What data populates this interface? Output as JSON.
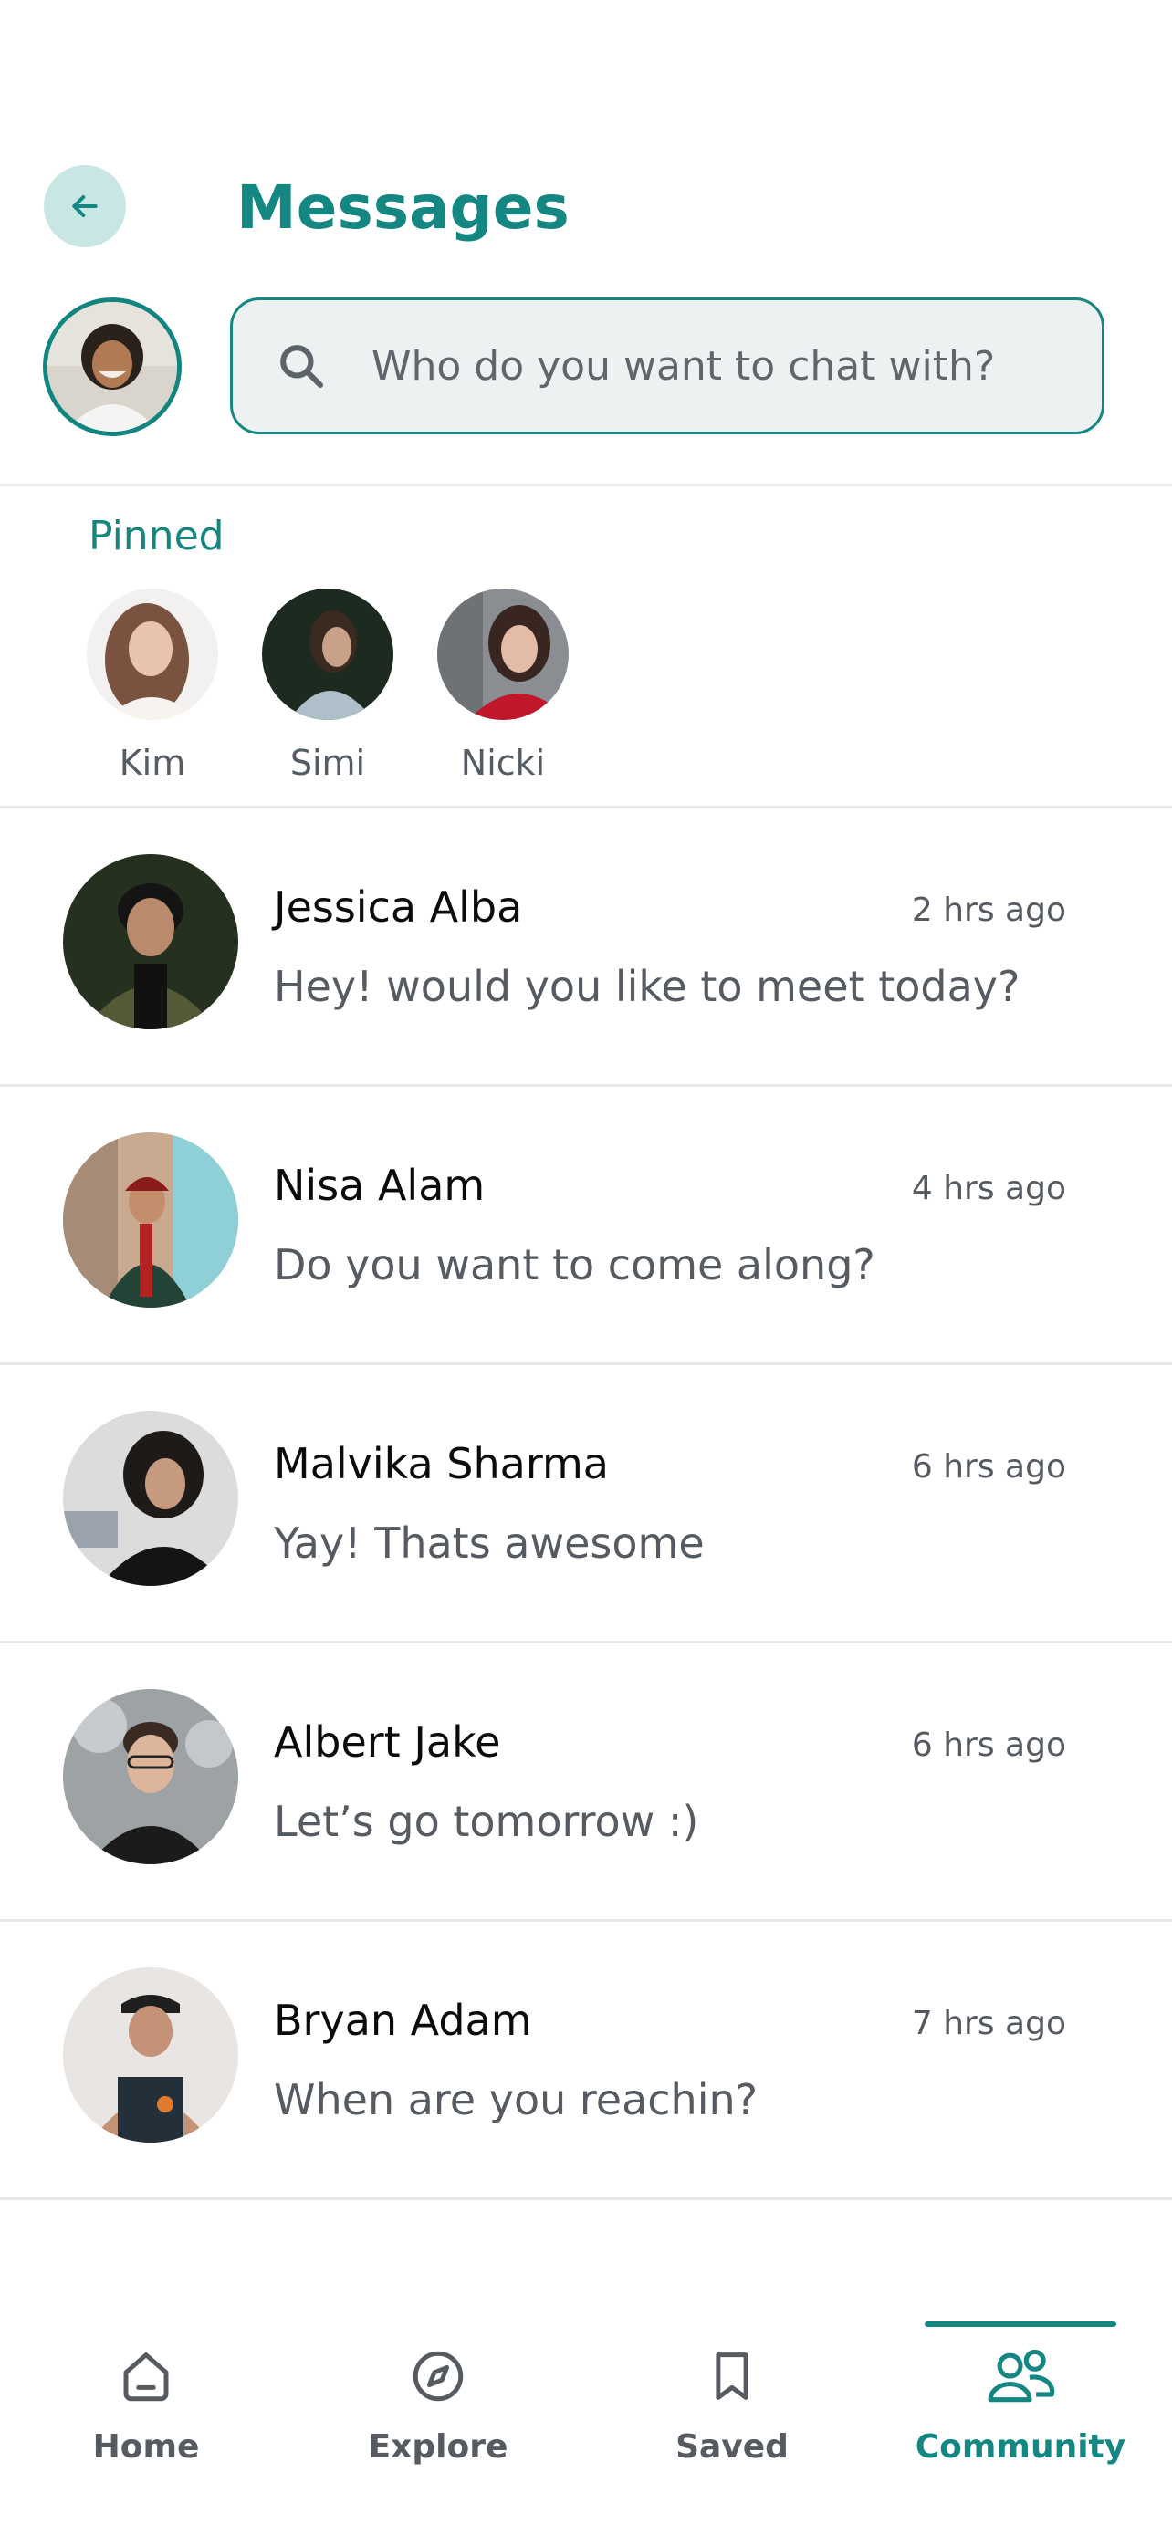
{
  "header": {
    "title": "Messages",
    "back_icon": "arrow-left-icon",
    "colors": {
      "accent": "#148783",
      "back_bg": "#c8e6e3",
      "search_bg": "#eef1f2"
    }
  },
  "search": {
    "placeholder": "Who do you want to chat with?",
    "value": "",
    "icon": "search-icon"
  },
  "pinned": {
    "title": "Pinned",
    "items": [
      {
        "name": "Kim"
      },
      {
        "name": "Simi"
      },
      {
        "name": "Nicki"
      }
    ]
  },
  "conversations": [
    {
      "name": "Jessica Alba",
      "time": "2 hrs ago",
      "message": "Hey! would you like to meet today?"
    },
    {
      "name": "Nisa Alam",
      "time": "4 hrs ago",
      "message": "Do you want to come along?"
    },
    {
      "name": "Malvika Sharma",
      "time": "6 hrs ago",
      "message": "Yay! Thats awesome"
    },
    {
      "name": "Albert Jake",
      "time": "6 hrs ago",
      "message": "Let’s go tomorrow :)"
    },
    {
      "name": "Bryan Adam",
      "time": "7 hrs ago",
      "message": "When are you reachin?"
    }
  ],
  "nav": {
    "items": [
      {
        "label": "Home",
        "icon": "home-icon"
      },
      {
        "label": "Explore",
        "icon": "compass-icon"
      },
      {
        "label": "Saved",
        "icon": "bookmark-icon"
      },
      {
        "label": "Community",
        "icon": "people-icon"
      }
    ],
    "active": "Community"
  }
}
